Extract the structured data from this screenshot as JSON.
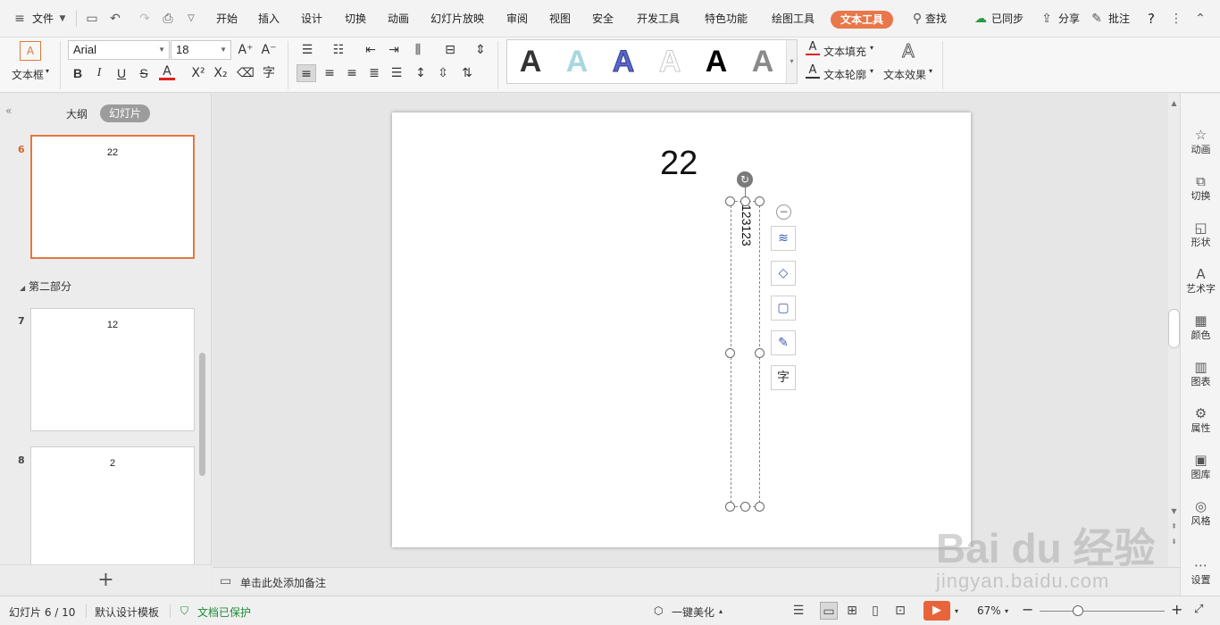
{
  "menubar": {
    "file_label": "文件",
    "tabs": [
      "开始",
      "插入",
      "设计",
      "切换",
      "动画",
      "幻灯片放映",
      "审阅",
      "视图",
      "安全",
      "开发工具",
      "特色功能",
      "绘图工具",
      "文本工具"
    ],
    "active_tab": "文本工具",
    "search_label": "查找",
    "sync_label": "已同步",
    "share_label": "分享",
    "comment_label": "批注",
    "help_label": "?"
  },
  "ribbon": {
    "textbox_label": "文本框",
    "font_name": "Arial",
    "font_size": "18",
    "bold": "B",
    "italic": "I",
    "underline": "U",
    "strike": "S",
    "grow_font": "A⁺",
    "shrink_font": "A⁻",
    "text_fill_label": "文本填充",
    "text_outline_label": "文本轮廓",
    "text_effect_label": "文本效果",
    "styles": [
      {
        "glyph": "A",
        "color": "#111111",
        "stroke": "none"
      },
      {
        "glyph": "A",
        "color": "#a9d6e0",
        "stroke": "none"
      },
      {
        "glyph": "A",
        "color": "#5a67c7",
        "stroke": "#2e3a9a"
      },
      {
        "glyph": "A",
        "color": "#ffffff",
        "stroke": "#c9c9c9"
      },
      {
        "glyph": "A",
        "color": "#000000",
        "stroke": "none"
      },
      {
        "glyph": "A",
        "color": "#8a8a8a",
        "stroke": "none"
      }
    ]
  },
  "left_panel": {
    "outline_tab": "大纲",
    "slides_tab": "幻灯片",
    "section_label": "第二部分",
    "slides": [
      {
        "number": "6",
        "text": "22",
        "selected": true
      },
      {
        "number": "7",
        "text": "12",
        "selected": false
      },
      {
        "number": "8",
        "text": "2",
        "selected": false
      }
    ],
    "add_label": "+"
  },
  "slide": {
    "title": "22",
    "textbox_text": "123123"
  },
  "notes": {
    "placeholder": "单击此处添加备注"
  },
  "right_sidebar": {
    "items": [
      {
        "label": "动画",
        "icon": "animation-icon"
      },
      {
        "label": "切换",
        "icon": "transition-icon"
      },
      {
        "label": "形状",
        "icon": "shape-icon"
      },
      {
        "label": "艺术字",
        "icon": "wordart-icon"
      },
      {
        "label": "颜色",
        "icon": "color-icon"
      },
      {
        "label": "图表",
        "icon": "chart-icon"
      },
      {
        "label": "属性",
        "icon": "properties-icon"
      },
      {
        "label": "图库",
        "icon": "gallery-icon"
      },
      {
        "label": "风格",
        "icon": "style-icon"
      },
      {
        "label": "设置",
        "icon": "settings-icon"
      }
    ]
  },
  "status": {
    "slide_counter": "幻灯片 6 / 10",
    "template": "默认设计模板",
    "protect": "文档已保护",
    "beautify": "一键美化",
    "zoom": "67%",
    "accent_color": "#e8643a"
  },
  "watermark": {
    "line1": "Bai du 经验",
    "line2": "jingyan.baidu.com"
  }
}
